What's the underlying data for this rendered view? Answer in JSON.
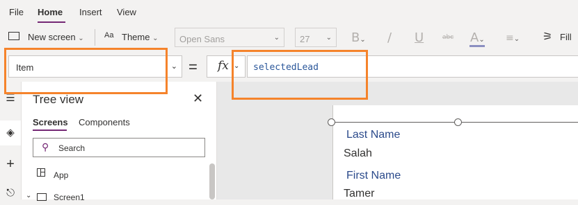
{
  "menu": {
    "items": [
      "File",
      "Home",
      "Insert",
      "View"
    ],
    "active": "Home",
    "accent_color": "#742774"
  },
  "toolbar": {
    "new_screen_label": "New screen",
    "theme_label": "Theme",
    "font_family_value": "Open Sans",
    "font_size_value": "27",
    "bold_glyph": "B",
    "italic_glyph": "/",
    "underline_glyph": "U",
    "strike_glyph": "abc",
    "font_color_glyph": "A",
    "fill_label": "Fill"
  },
  "formula_bar": {
    "property_value": "Item",
    "equals": "=",
    "fx_label": "fx",
    "formula_text": "selectedLead",
    "formula_color": "#2b579a",
    "highlight_color": "#f5832b"
  },
  "tree_view": {
    "title": "Tree view",
    "tabs": [
      "Screens",
      "Components"
    ],
    "active_tab": "Screens",
    "search_placeholder": "Search",
    "items": [
      {
        "label": "App",
        "icon": "app-icon"
      },
      {
        "label": "Screen1",
        "icon": "screen-icon"
      }
    ]
  },
  "canvas": {
    "fields": [
      {
        "label": "Last Name",
        "value": "Salah"
      },
      {
        "label": "First Name",
        "value": "Tamer"
      }
    ],
    "label_color": "#2b4a8b"
  }
}
